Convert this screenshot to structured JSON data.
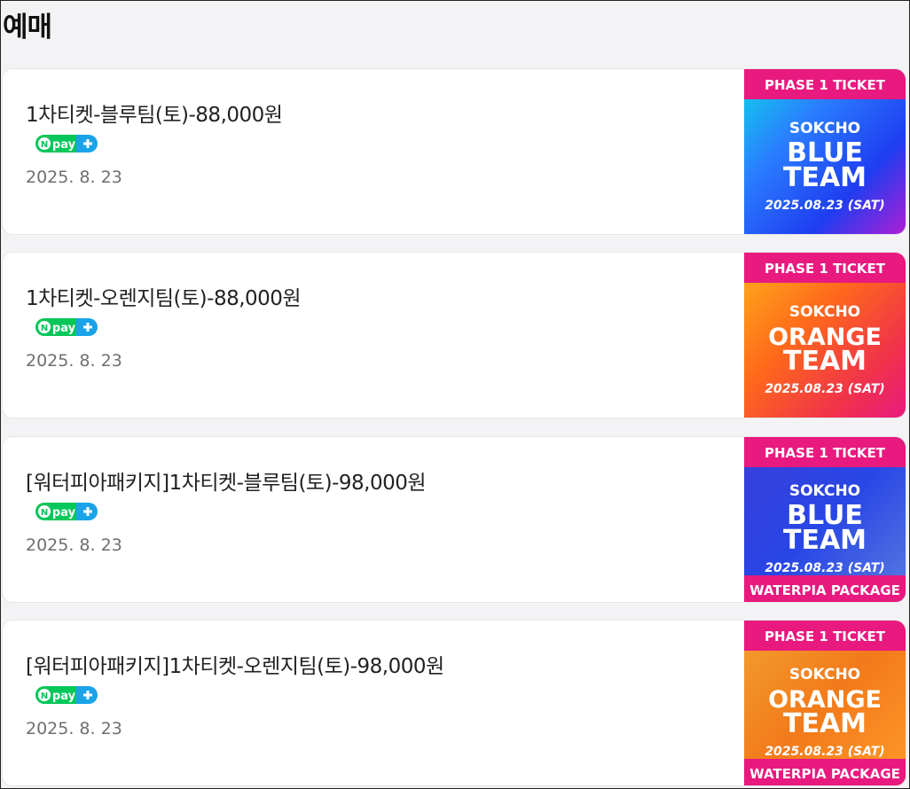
{
  "heading": "예매",
  "pay_badge": {
    "n": "N",
    "text": "pay"
  },
  "tickets": [
    {
      "title": "1차티켓-블루팀(토)-88,000원",
      "date": "2025. 8. 23",
      "image": {
        "top_label": "PHASE 1 TICKET",
        "city": "SOKCHO",
        "team_line1": "BLUE",
        "team_line2": "TEAM",
        "event_date": "2025.08.23 (SAT)",
        "bottom_label": "",
        "theme": "blue"
      }
    },
    {
      "title": "1차티켓-오렌지팀(토)-88,000원",
      "date": "2025. 8. 23",
      "image": {
        "top_label": "PHASE 1 TICKET",
        "city": "SOKCHO",
        "team_line1": "ORANGE",
        "team_line2": "TEAM",
        "event_date": "2025.08.23 (SAT)",
        "bottom_label": "",
        "theme": "orange"
      }
    },
    {
      "title": "[워터피아패키지]1차티켓-블루팀(토)-98,000원",
      "date": "2025. 8. 23",
      "image": {
        "top_label": "PHASE 1 TICKET",
        "city": "SOKCHO",
        "team_line1": "BLUE",
        "team_line2": "TEAM",
        "event_date": "2025.08.23 (SAT)",
        "bottom_label": "WATERPIA PACKAGE",
        "theme": "blue-pkg"
      }
    },
    {
      "title": "[워터피아패키지]1차티켓-오렌지팀(토)-98,000원",
      "date": "2025. 8. 23",
      "image": {
        "top_label": "PHASE 1 TICKET",
        "city": "SOKCHO",
        "team_line1": "ORANGE",
        "team_line2": "TEAM",
        "event_date": "2025.08.23 (SAT)",
        "bottom_label": "WATERPIA PACKAGE",
        "theme": "orange-pkg"
      }
    }
  ],
  "colors": {
    "pink": "#e8197f",
    "npay_green": "#03c75a",
    "npay_blue": "#1aa3e8",
    "title": "#222222",
    "date": "#6f6f6f"
  }
}
